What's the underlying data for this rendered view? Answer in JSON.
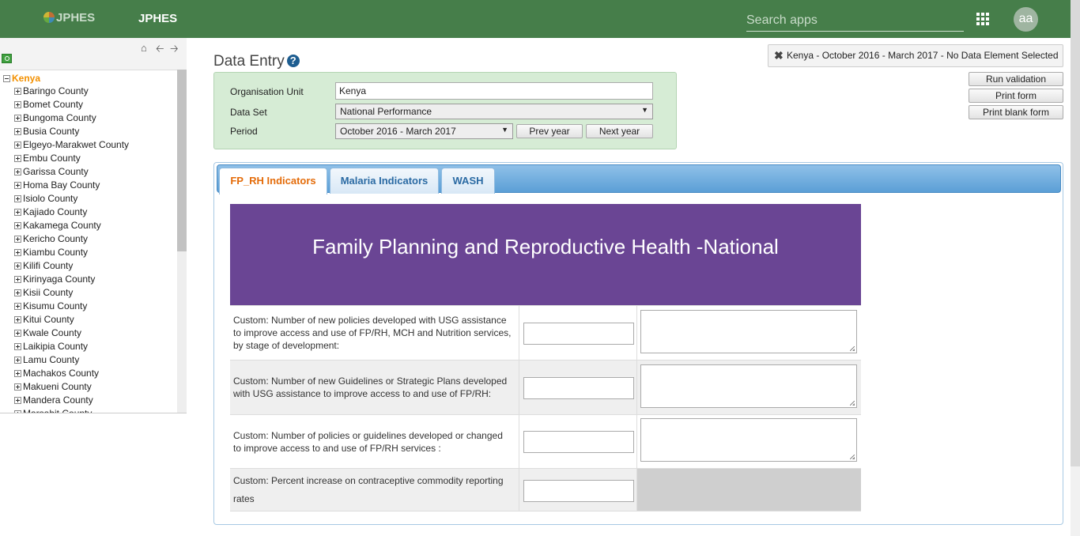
{
  "header": {
    "logo_text": "JPHES",
    "app_title": "JPHES",
    "search_placeholder": "Search apps",
    "avatar_initials": "aa"
  },
  "tree": {
    "root": "Kenya",
    "items": [
      "Baringo County",
      "Bomet County",
      "Bungoma County",
      "Busia County",
      "Elgeyo-Marakwet County",
      "Embu County",
      "Garissa County",
      "Homa Bay County",
      "Isiolo County",
      "Kajiado County",
      "Kakamega County",
      "Kericho County",
      "Kiambu County",
      "Kilifi County",
      "Kirinyaga County",
      "Kisii County",
      "Kisumu County",
      "Kitui County",
      "Kwale County",
      "Laikipia County",
      "Lamu County",
      "Machakos County",
      "Makueni County",
      "Mandera County",
      "Marsabit County"
    ]
  },
  "main": {
    "title": "Data Entry",
    "help_symbol": "?",
    "selection": {
      "org_unit_label": "Organisation Unit",
      "org_unit_value": "Kenya",
      "dataset_label": "Data Set",
      "dataset_value": "National Performance",
      "period_label": "Period",
      "period_value": "October 2016 - March 2017",
      "prev_year": "Prev year",
      "next_year": "Next year"
    },
    "info_text": "Kenya - October 2016 - March 2017 - No Data Element Selected",
    "buttons": {
      "run_validation": "Run validation",
      "print_form": "Print form",
      "print_blank_form": "Print blank form"
    },
    "tabs": [
      "FP_RH Indicators",
      "Malaria Indicators",
      "WASH"
    ],
    "form_title": "Family Planning and Reproductive Health -National",
    "rows": [
      "Custom: Number  of new policies developed with USG assistance to improve access and use of FP/RH, MCH and Nutrition services, by stage of development:",
      "Custom: Number of new Guidelines or Strategic Plans developed with USG assistance to improve access to and use of FP/RH:",
      "Custom: Number of policies or guidelines developed or changed to improve access to and use of FP/RH services :",
      "Custom: Percent increase on contraceptive commodity reporting rates"
    ]
  },
  "colors": {
    "header_bg": "#467e4a",
    "form_header_bg": "#6a4594",
    "active_tab_text": "#e46c0a",
    "tree_root": "#f39000"
  }
}
